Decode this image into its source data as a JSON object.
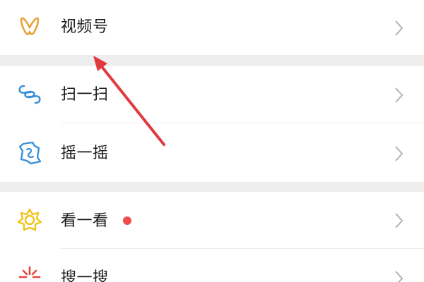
{
  "menu": {
    "channels": {
      "label": "视频号",
      "icon": "channels-butterfly-icon",
      "icon_color": "#E8A33A"
    },
    "scan": {
      "label": "扫一扫",
      "icon": "scan-icon",
      "icon_color": "#3A8FD8"
    },
    "shake": {
      "label": "摇一摇",
      "icon": "shake-icon",
      "icon_color": "#3A8FD8"
    },
    "top_stories": {
      "label": "看一看",
      "icon": "top-stories-icon",
      "icon_color": "#F2C318",
      "badge_color": "#F04D4D"
    },
    "search": {
      "label": "搜一搜",
      "icon": "search-spark-icon",
      "icon_color": "#E8453C"
    }
  },
  "colors": {
    "divider": "#EEEEEE",
    "chevron": "#B2B2B2",
    "annotation_arrow": "#E0393E"
  }
}
